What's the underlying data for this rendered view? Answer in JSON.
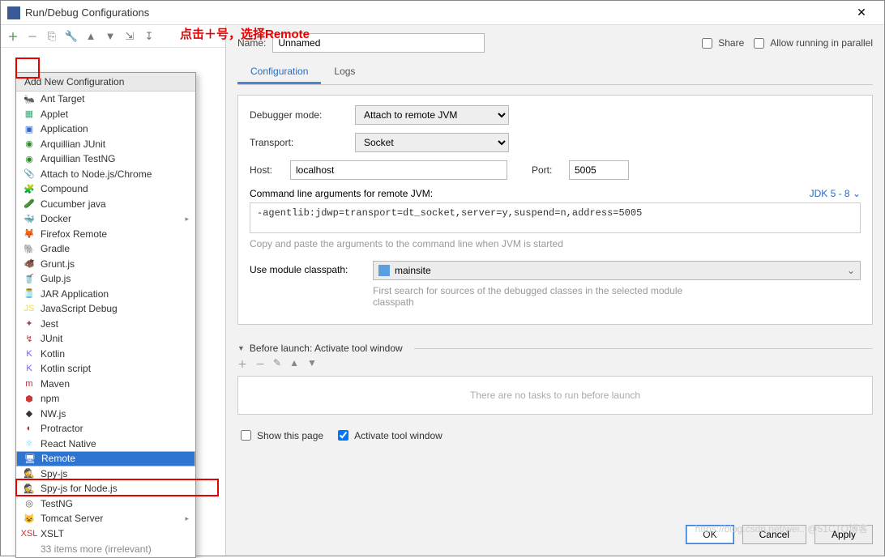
{
  "title": "Run/Debug Configurations",
  "annotation": "点击＋号，选择Remote",
  "toolbar_icons": [
    "＋",
    "－",
    "⎘",
    "🔧",
    "▲",
    "▼",
    "⇲",
    "↧"
  ],
  "dropdown": {
    "header": "Add New Configuration",
    "more": "33 items more (irrelevant)",
    "items": [
      {
        "label": "Ant Target",
        "icon": "🐜",
        "c": "#555"
      },
      {
        "label": "Applet",
        "icon": "▦",
        "c": "#3a7"
      },
      {
        "label": "Application",
        "icon": "▣",
        "c": "#36c"
      },
      {
        "label": "Arquillian JUnit",
        "icon": "◉",
        "c": "#2a8a2a"
      },
      {
        "label": "Arquillian TestNG",
        "icon": "◉",
        "c": "#2a8a2a"
      },
      {
        "label": "Attach to Node.js/Chrome",
        "icon": "📎",
        "c": "#c33"
      },
      {
        "label": "Compound",
        "icon": "🧩",
        "c": "#888"
      },
      {
        "label": "Cucumber java",
        "icon": "🥒",
        "c": "#2a8a2a"
      },
      {
        "label": "Docker",
        "icon": "🐳",
        "c": "#0db7ed",
        "chev": true
      },
      {
        "label": "Firefox Remote",
        "icon": "🦊",
        "c": "#e55b0a"
      },
      {
        "label": "Gradle",
        "icon": "🐘",
        "c": "#02303a"
      },
      {
        "label": "Grunt.js",
        "icon": "🐗",
        "c": "#e48632"
      },
      {
        "label": "Gulp.js",
        "icon": "🥤",
        "c": "#cf4647"
      },
      {
        "label": "JAR Application",
        "icon": "🫙",
        "c": "#a67"
      },
      {
        "label": "JavaScript Debug",
        "icon": "JS",
        "c": "#f0db4f"
      },
      {
        "label": "Jest",
        "icon": "✦",
        "c": "#99425b"
      },
      {
        "label": "JUnit",
        "icon": "↯",
        "c": "#c33"
      },
      {
        "label": "Kotlin",
        "icon": "K",
        "c": "#7f52ff"
      },
      {
        "label": "Kotlin script",
        "icon": "K",
        "c": "#7f52ff"
      },
      {
        "label": "Maven",
        "icon": "m",
        "c": "#c71a36"
      },
      {
        "label": "npm",
        "icon": "⬢",
        "c": "#cb3837"
      },
      {
        "label": "NW.js",
        "icon": "◆",
        "c": "#333"
      },
      {
        "label": "Protractor",
        "icon": "◐",
        "c": "#b52e31"
      },
      {
        "label": "React Native",
        "icon": "⚛",
        "c": "#61dafb"
      },
      {
        "label": "Remote",
        "icon": "🖥",
        "c": "#fff",
        "selected": true
      },
      {
        "label": "Spy-js",
        "icon": "🕵",
        "c": "#555"
      },
      {
        "label": "Spy-js for Node.js",
        "icon": "🕵",
        "c": "#3a8"
      },
      {
        "label": "TestNG",
        "icon": "◎",
        "c": "#555"
      },
      {
        "label": "Tomcat Server",
        "icon": "😺",
        "c": "#d2a41c",
        "chev": true
      },
      {
        "label": "XSLT",
        "icon": "XSL",
        "c": "#c33"
      }
    ]
  },
  "name_label": "Name:",
  "name_value": "Unnamed",
  "share_label": "Share",
  "parallel_label": "Allow running in parallel",
  "tabs": {
    "config": "Configuration",
    "logs": "Logs"
  },
  "form": {
    "debugger_mode_label": "Debugger mode:",
    "debugger_mode_value": "Attach to remote JVM",
    "transport_label": "Transport:",
    "transport_value": "Socket",
    "host_label": "Host:",
    "host_value": "localhost",
    "port_label": "Port:",
    "port_value": "5005",
    "cmdline_label": "Command line arguments for remote JVM:",
    "jdk": "JDK 5 - 8 ⌄",
    "cmdline": "-agentlib:jdwp=transport=dt_socket,server=y,suspend=n,address=5005",
    "hint1": "Copy and paste the arguments to the command line when JVM is started",
    "module_label": "Use module classpath:",
    "module_value": "mainsite",
    "hint2": "First search for sources of the debugged classes in the selected module classpath"
  },
  "before_launch": {
    "title": "Before launch: Activate tool window",
    "empty": "There are no tasks to run before launch",
    "show_page": "Show this page",
    "activate": "Activate tool window"
  },
  "buttons": {
    "ok": "OK",
    "cancel": "Cancel",
    "apply": "Apply"
  },
  "watermark": "https://blog.csdn.net/wei...@51CTO博客"
}
